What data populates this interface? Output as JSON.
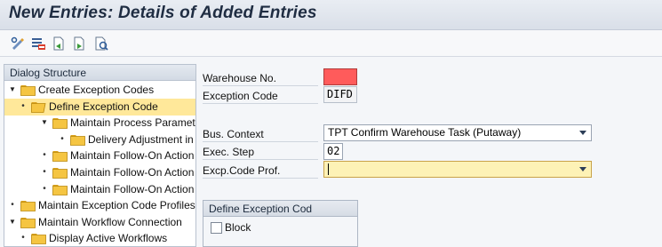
{
  "window": {
    "title": "New Entries: Details of Added Entries"
  },
  "toolbar": {
    "buttons": [
      {
        "icon": "display-change-icon"
      },
      {
        "icon": "delete-entry-icon"
      },
      {
        "icon": "previous-entry-icon"
      },
      {
        "icon": "next-entry-icon"
      },
      {
        "icon": "variable-list-icon"
      }
    ]
  },
  "tree": {
    "header": "Dialog Structure",
    "items": [
      {
        "label": "Create Exception Codes",
        "level": 0,
        "expanded": true,
        "folder": true
      },
      {
        "label": "Define Exception Code",
        "level": 1,
        "selected": true,
        "folder": true,
        "open": true
      },
      {
        "label": "Maintain Process Paramet",
        "level": 2,
        "expanded": true,
        "folder": true
      },
      {
        "label": "Delivery Adjustment in",
        "level": 3,
        "folder": true
      },
      {
        "label": "Maintain Follow-On Action",
        "level": 2,
        "folder": true
      },
      {
        "label": "Maintain Follow-On Action",
        "level": 2,
        "folder": true
      },
      {
        "label": "Maintain Follow-On Action",
        "level": 2,
        "folder": true
      },
      {
        "label": "Maintain Exception Code Profiles",
        "level": 0,
        "folder": true
      },
      {
        "label": "Maintain Workflow Connection",
        "level": 0,
        "expanded": true,
        "folder": true
      },
      {
        "label": "Display Active Workflows",
        "level": 1,
        "folder": true
      }
    ]
  },
  "form": {
    "warehouse_label": "Warehouse No.",
    "warehouse_value": "",
    "exception_code_label": "Exception Code",
    "exception_code_value": "DIFD",
    "bus_context_label": "Bus. Context",
    "bus_context_value": "TPT Confirm Warehouse Task (Putaway)",
    "exec_step_label": "Exec. Step",
    "exec_step_value": "02",
    "excp_profile_label": "Excp.Code Prof.",
    "excp_profile_value": ""
  },
  "group": {
    "title": "Define Exception Cod",
    "block_label": "Block",
    "block_checked": false
  },
  "colors": {
    "selection": "#ffe89a",
    "required_field": "#ff5b5b",
    "active_field": "#fdf2b6",
    "folder": "#f5c542"
  }
}
